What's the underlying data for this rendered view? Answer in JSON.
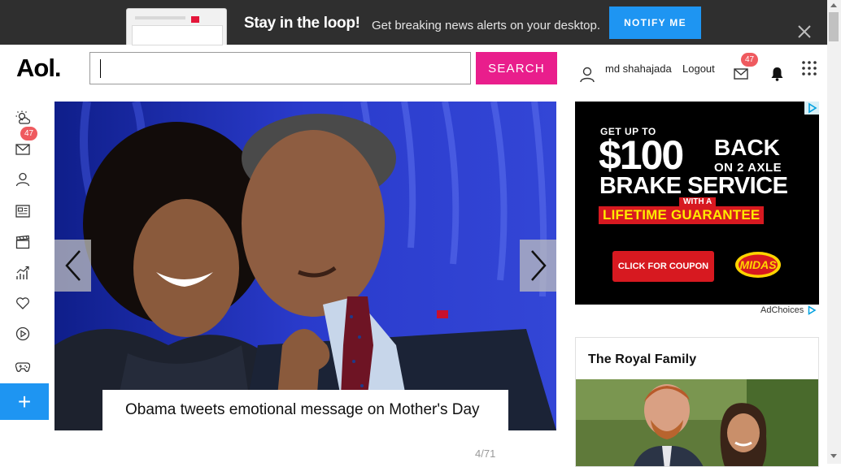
{
  "notification_bar": {
    "title": "Stay in the loop!",
    "subtitle": "Get breaking news alerts on your desktop.",
    "button_label": "NOTIFY ME",
    "close_icon": "close-icon"
  },
  "header": {
    "logo": "Aol.",
    "search": {
      "value": "",
      "placeholder": ""
    },
    "search_button_label": "SEARCH",
    "username": "md shahajada",
    "logout_label": "Logout",
    "mail_badge": "47"
  },
  "left_rail": {
    "items": [
      {
        "name": "weather",
        "icon": "weather-icon"
      },
      {
        "name": "mail",
        "icon": "mail-icon",
        "badge": "47"
      },
      {
        "name": "profile",
        "icon": "user-icon"
      },
      {
        "name": "news",
        "icon": "news-icon"
      },
      {
        "name": "entertainment",
        "icon": "clapperboard-icon"
      },
      {
        "name": "finance",
        "icon": "chart-icon"
      },
      {
        "name": "lifestyle",
        "icon": "heart-icon"
      },
      {
        "name": "video",
        "icon": "play-icon"
      },
      {
        "name": "games",
        "icon": "gamepad-icon"
      }
    ],
    "plus_label": "+"
  },
  "slideshow": {
    "caption": "Obama tweets emotional message on Mother's Day",
    "counter": "4/71"
  },
  "ad": {
    "line1": "GET UP TO",
    "amount": "$100",
    "back": "BACK",
    "axle": "ON 2 AXLE",
    "service": "BRAKE SERVICE",
    "with": "WITH A",
    "guarantee": "LIFETIME GUARANTEE",
    "coupon_label": "CLICK FOR COUPON",
    "brand": "MIDAS",
    "adchoices": "AdChoices"
  },
  "royal_card": {
    "title": "The Royal Family"
  },
  "colors": {
    "notif_bg": "#2f2f2f",
    "notify_blue": "#1e95f2",
    "search_pink": "#e91e8c",
    "badge_red": "#ef5a5f",
    "ad_red": "#d71920",
    "ad_yellow": "#ffea00"
  }
}
